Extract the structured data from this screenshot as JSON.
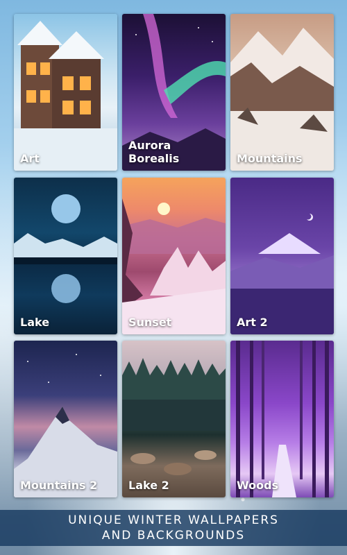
{
  "tiles": [
    {
      "label": "Art"
    },
    {
      "label": "Aurora Borealis"
    },
    {
      "label": "Mountains"
    },
    {
      "label": "Lake"
    },
    {
      "label": "Sunset"
    },
    {
      "label": "Art 2"
    },
    {
      "label": "Mountains 2"
    },
    {
      "label": "Lake 2"
    },
    {
      "label": "Woods"
    }
  ],
  "banner": {
    "line1": "UNIQUE WINTER WALLPAPERS",
    "line2": "AND BACKGROUNDS"
  }
}
